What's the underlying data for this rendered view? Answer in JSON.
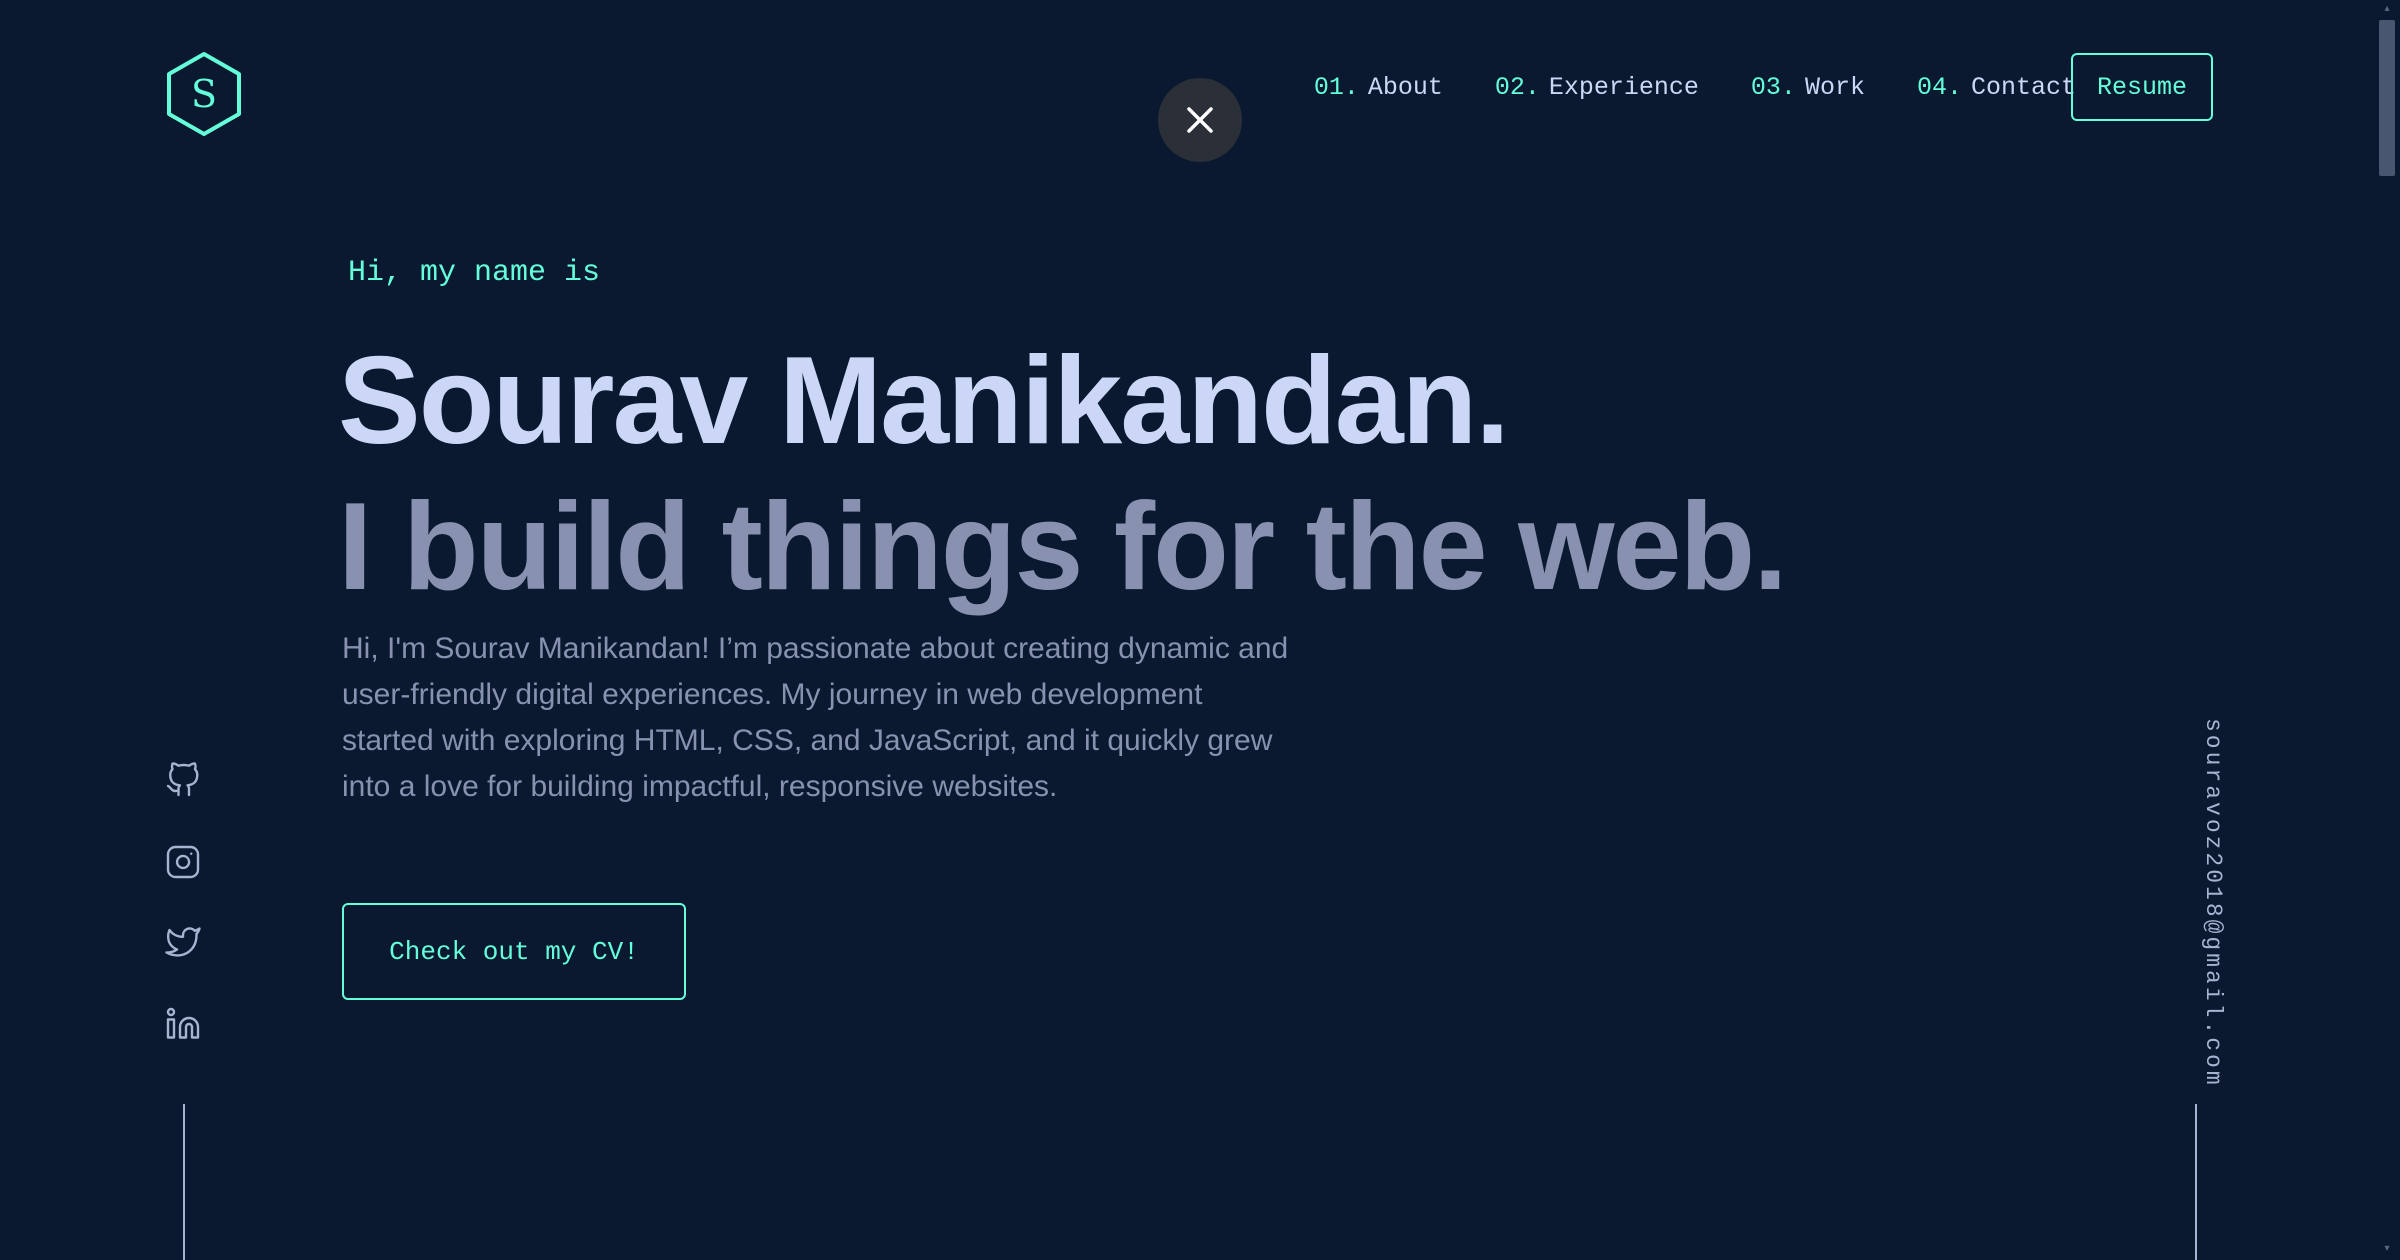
{
  "brand": {
    "logo_letter": "S",
    "accent_color": "#64ffda",
    "background_color": "#0a192f"
  },
  "nav": {
    "items": [
      {
        "number": "01.",
        "label": "About"
      },
      {
        "number": "02.",
        "label": "Experience"
      },
      {
        "number": "03.",
        "label": "Work"
      },
      {
        "number": "04.",
        "label": "Contact"
      }
    ],
    "resume_label": "Resume"
  },
  "close_button": {
    "icon": "close-icon"
  },
  "hero": {
    "greeting": "Hi, my name is",
    "name": "Sourav Manikandan.",
    "tagline": "I build things for the web.",
    "bio": "Hi, I'm Sourav Manikandan! I’m passionate about creating dynamic and user-friendly digital experiences. My journey in web development started with exploring HTML, CSS, and JavaScript, and it quickly grew into a love for building impactful, responsive websites.",
    "cta_label": "Check out my CV!"
  },
  "social": {
    "icons": [
      "github-icon",
      "instagram-icon",
      "twitter-icon",
      "linkedin-icon"
    ]
  },
  "email": "souravoz2018@gmail.com"
}
